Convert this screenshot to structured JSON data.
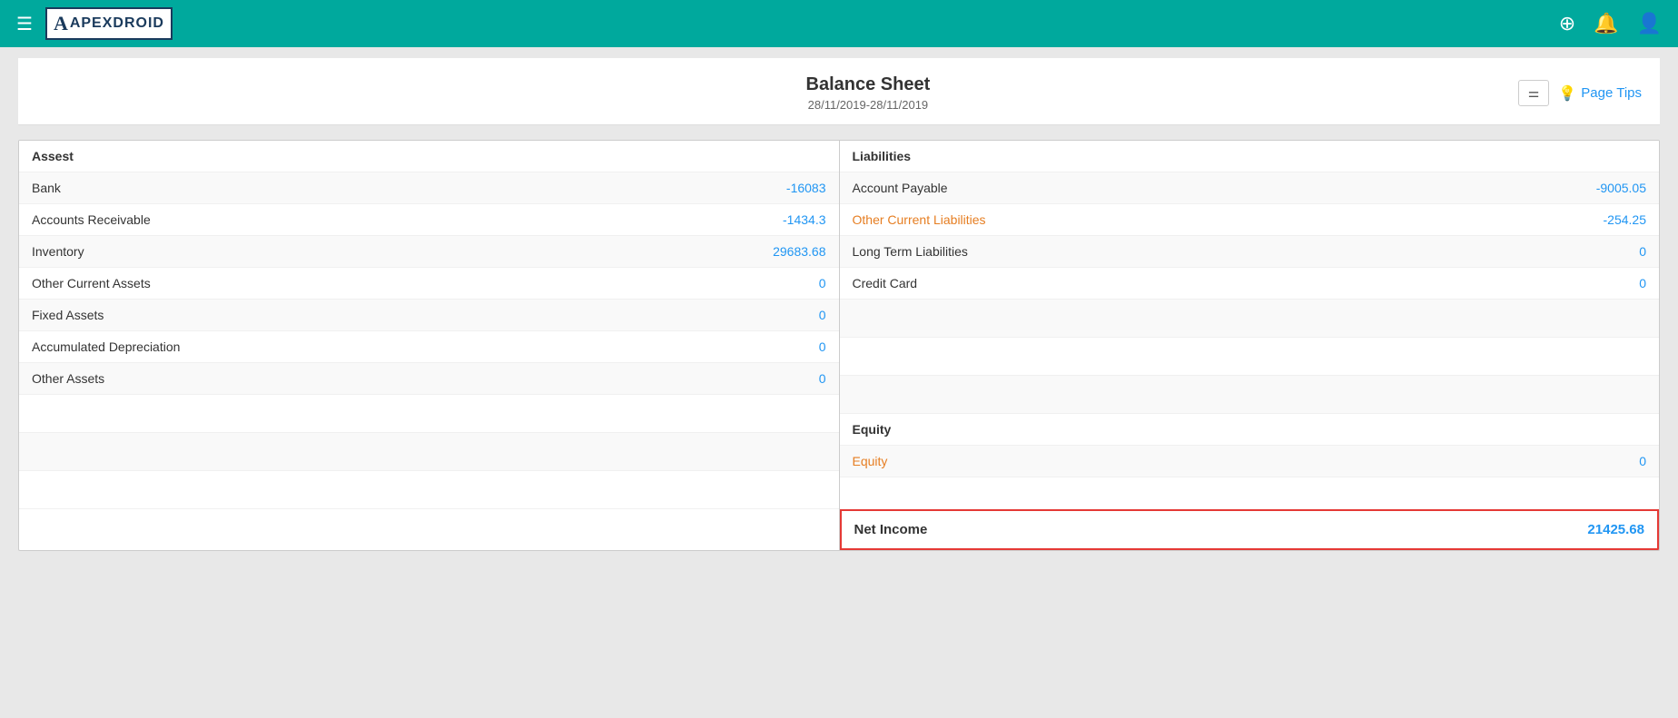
{
  "app": {
    "name": "APEXDROID"
  },
  "header": {
    "title": "Balance Sheet",
    "date_range": "28/11/2019-28/11/2019",
    "filter_label": "≡",
    "page_tips_label": "Page Tips"
  },
  "assets": {
    "section_label": "Assest",
    "rows": [
      {
        "label": "Bank",
        "value": "-16083",
        "color": "blue"
      },
      {
        "label": "Accounts Receivable",
        "value": "-1434.3",
        "color": "blue"
      },
      {
        "label": "Inventory",
        "value": "29683.68",
        "color": "blue"
      },
      {
        "label": "Other Current Assets",
        "value": "0",
        "color": "blue"
      },
      {
        "label": "Fixed Assets",
        "value": "0",
        "color": "blue"
      },
      {
        "label": "Accumulated Depreciation",
        "value": "0",
        "color": "blue"
      },
      {
        "label": "Other Assets",
        "value": "0",
        "color": "blue"
      }
    ]
  },
  "liabilities": {
    "section_label": "Liabilities",
    "rows": [
      {
        "label": "Account Payable",
        "value": "-9005.05",
        "color": "blue"
      },
      {
        "label": "Other Current Liabilities",
        "value": "-254.25",
        "color": "orange"
      },
      {
        "label": "Long Term Liabilities",
        "value": "0",
        "color": "blue"
      },
      {
        "label": "Credit Card",
        "value": "0",
        "color": "blue"
      }
    ]
  },
  "equity": {
    "section_label": "Equity",
    "rows": [
      {
        "label": "Equity",
        "value": "0",
        "color": "blue"
      }
    ]
  },
  "net_income": {
    "label": "Net Income",
    "value": "21425.68",
    "color": "blue"
  },
  "colors": {
    "teal": "#00a99d",
    "blue_link": "#2196F3",
    "orange": "#e67e22",
    "red_border": "#e53935",
    "dark_text": "#1a3a5c"
  }
}
